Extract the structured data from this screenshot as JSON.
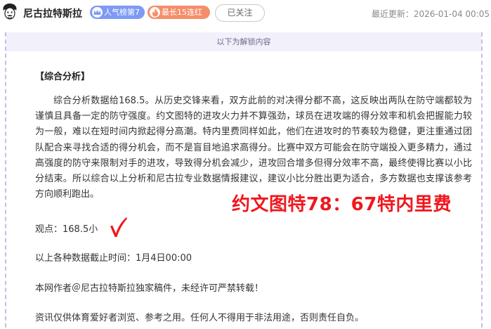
{
  "header": {
    "author_name": "尼古拉特斯拉",
    "badge_popularity": "人气榜第7",
    "badge_streak": "最长15连红",
    "follow_label": "已关注",
    "update_label": "最近更新：",
    "update_time": "2026-01-04 00:05"
  },
  "article": {
    "unlock_notice": "以下为解锁内容",
    "section_heading": "【综合分析】",
    "analysis_paragraph": "综合分析数据给168.5。从历史交锋来看，双方此前的对决得分都不高，这反映出两队在防守端都较为谨慎且具备一定的防守强度。约文图特的进攻火力并不算强劲，球员在进攻端的得分效率和机会把握能力较为一般，难以在短时间内掀起得分高潮。特内里费同样如此，他们在进攻时的节奏较为稳健，更注重通过团队配合来寻找合适的得分机会，而不是盲目地追求高得分。比赛中双方可能会在防守端投入更多精力，通过高强度的防守来限制对手的进攻，导致得分机会减少，进攻回合增多但得分效率不高，最终使得比赛以小比分结束。所以综合以上分析和尼古拉专业数据情报建议，建议小比分胜出更为适合，多方数据也支撑该参考方向顺利跑出。",
    "result_overlay": "约文图特78：67特内里费",
    "viewpoint": "观点：168.5小",
    "data_cutoff": "以上各种数据截止时间：1月4日00:00",
    "copyright": "本网作者＠尼古拉特斯拉独家稿件，未经许可严禁转载！",
    "disclaimer": "资讯仅供体育爱好者浏览、参考之用。任何人不得用于非法用途，否则责任自负。"
  },
  "colors": {
    "result_red": "#f0171d",
    "badge_popularity": "#7e9af5",
    "badge_streak": "#f58e6a",
    "dashed_border": "#c5bfe6"
  },
  "icons": {
    "avatar": "einstein-avatar-icon",
    "popularity": "crown-icon",
    "streak": "flame-icon",
    "result": "red-checkmark-icon"
  }
}
